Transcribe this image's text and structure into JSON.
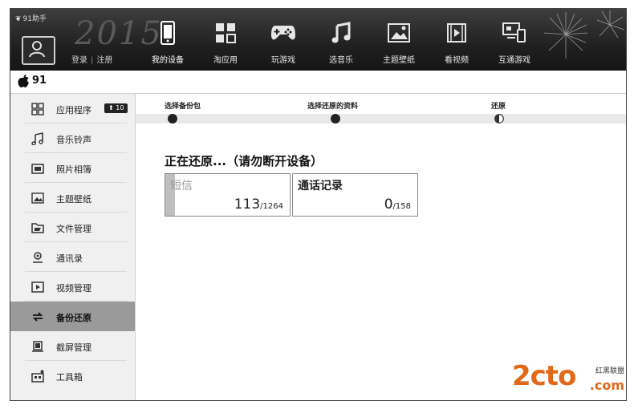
{
  "app": {
    "brand": "91助手",
    "year_watermark": "2015"
  },
  "account": {
    "login_label": "登录",
    "register_label": "注册"
  },
  "nav": [
    {
      "label": "我的设备",
      "icon": "phone-icon"
    },
    {
      "label": "淘应用",
      "icon": "apps-grid-icon"
    },
    {
      "label": "玩游戏",
      "icon": "gamepad-icon"
    },
    {
      "label": "选音乐",
      "icon": "music-note-icon"
    },
    {
      "label": "主题壁纸",
      "icon": "wallpaper-icon"
    },
    {
      "label": "看视频",
      "icon": "film-icon"
    },
    {
      "label": "互通游戏",
      "icon": "multi-device-icon"
    }
  ],
  "device": {
    "name": "91"
  },
  "sidebar": {
    "items": [
      {
        "label": "应用程序",
        "icon": "apps-icon",
        "badge": "10"
      },
      {
        "label": "音乐铃声",
        "icon": "music-icon"
      },
      {
        "label": "照片相簿",
        "icon": "photo-icon"
      },
      {
        "label": "主题壁纸",
        "icon": "wallpaper-icon"
      },
      {
        "label": "文件管理",
        "icon": "folder-icon"
      },
      {
        "label": "通讯录",
        "icon": "contacts-icon"
      },
      {
        "label": "视频管理",
        "icon": "video-icon"
      },
      {
        "label": "备份还原",
        "icon": "backup-icon",
        "active": true
      },
      {
        "label": "截屏管理",
        "icon": "screenshot-icon"
      },
      {
        "label": "工具箱",
        "icon": "toolbox-icon"
      }
    ]
  },
  "steps": {
    "items": [
      {
        "label": "选择备份包",
        "state": "done"
      },
      {
        "label": "选择还原的资料",
        "state": "done"
      },
      {
        "label": "还原",
        "state": "in-progress"
      }
    ]
  },
  "restore": {
    "title": "正在还原...（请勿断开设备）",
    "cards": [
      {
        "name": "短信",
        "done": "113",
        "total": "/1264",
        "progress": 0.09
      },
      {
        "name": "通话记录",
        "done": "0",
        "total": "/158",
        "progress": 0.0
      }
    ]
  },
  "watermark": {
    "logo": "2cto",
    "side_text": "红黑联盟",
    "domain": ".com"
  }
}
